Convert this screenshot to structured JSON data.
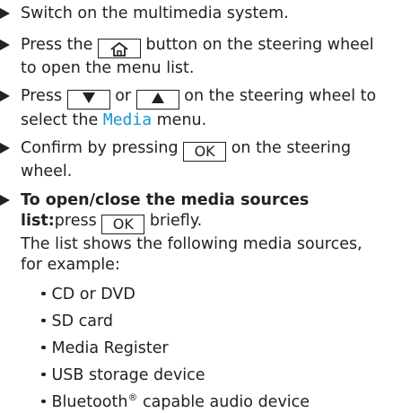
{
  "steps": [
    {
      "text": "Switch on the multimedia system."
    },
    {
      "pre": "Press the",
      "key_icon": "home-icon",
      "post_line1": "button on the steering wheel",
      "line2": "to open the menu list."
    },
    {
      "pre": "Press",
      "key_down": "▼",
      "mid": "or",
      "key_up": "▲",
      "post_line1": "on the steering wheel to",
      "line2_pre": "select the",
      "menu_name": "Media",
      "line2_post": "menu."
    },
    {
      "pre": "Confirm by pressing",
      "key_ok": "OK",
      "post_line1": "on the steering",
      "line2": "wheel."
    },
    {
      "bold_line1": "To open/close the media sources",
      "bold_line2": "list:",
      "pre2": "press",
      "key_ok": "OK",
      "post2": "briefly.",
      "line3": "The list shows the following media sources,",
      "line4": "for example:"
    }
  ],
  "media_sources": [
    "CD or DVD",
    "SD card",
    "Media Register",
    "USB storage device",
    {
      "text": "Bluetooth",
      "sup": "®",
      "suffix": " capable audio device"
    }
  ],
  "colors": {
    "text": "#222222",
    "accent": "#1696d2"
  }
}
